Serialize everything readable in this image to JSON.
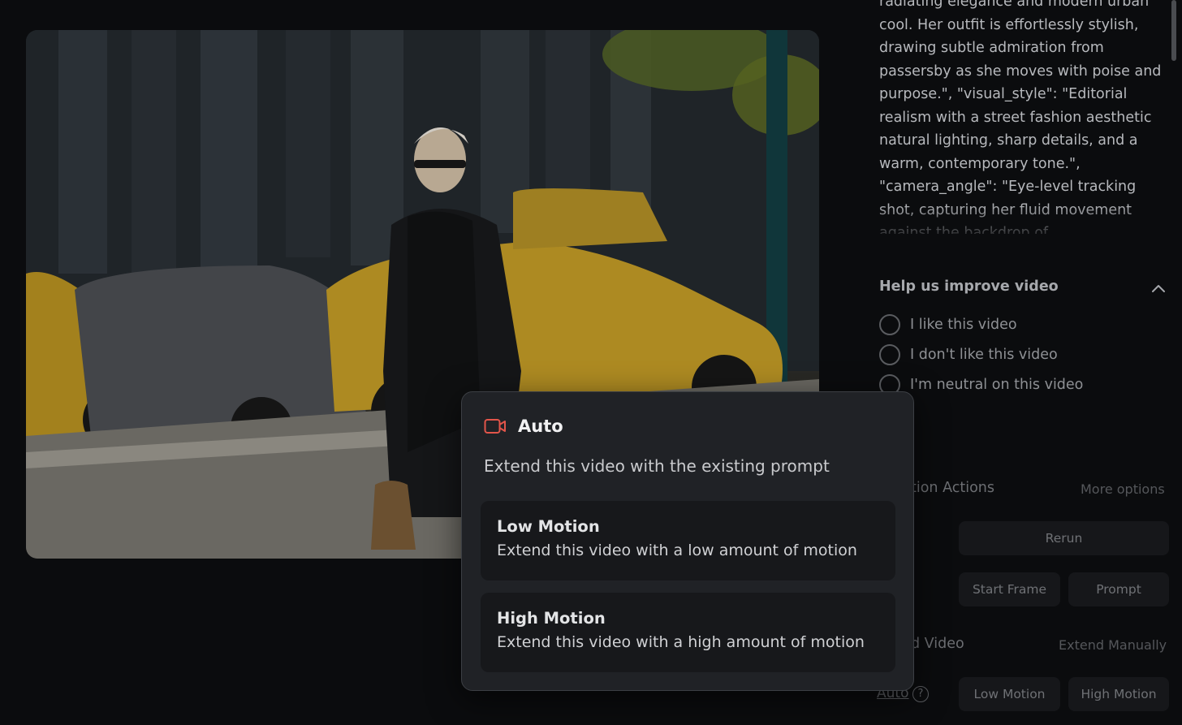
{
  "prompt_panel": {
    "text": "radiating elegance and modern urban cool. Her outfit is effortlessly stylish, drawing subtle admiration from passersby as she moves with poise and purpose.\", \"visual_style\": \"Editorial realism with a street fashion aesthetic natural lighting, sharp details, and a warm, contemporary tone.\", \"camera_angle\": \"Eye-level tracking shot, capturing her fluid movement against the backdrop of"
  },
  "feedback": {
    "title": "Help us improve video",
    "options": [
      {
        "label": "I like this video"
      },
      {
        "label": "I don't like this video"
      },
      {
        "label": "I'm neutral on this video"
      }
    ]
  },
  "generation_actions": {
    "label": "tion Actions",
    "more_options": "More options",
    "rerun": "Rerun",
    "start_frame": "Start Frame",
    "prompt": "Prompt"
  },
  "extend_video": {
    "label": "d Video",
    "extend_manually": "Extend Manually",
    "auto": "Auto",
    "help": "?",
    "low_motion": "Low Motion",
    "high_motion": "High Motion"
  },
  "popup": {
    "title": "Auto",
    "description": "Extend this video with the existing prompt",
    "options": [
      {
        "title": "Low Motion",
        "description": "Extend this video with a low amount of motion"
      },
      {
        "title": "High Motion",
        "description": "Extend this video with a high amount of motion"
      }
    ]
  },
  "colors": {
    "accent_icon": "#e2554a",
    "popup_bg": "#202226",
    "page_bg": "#0b0c0e"
  },
  "icons": [
    "video-camera-icon",
    "chevron-up-icon",
    "help-circle-icon"
  ]
}
